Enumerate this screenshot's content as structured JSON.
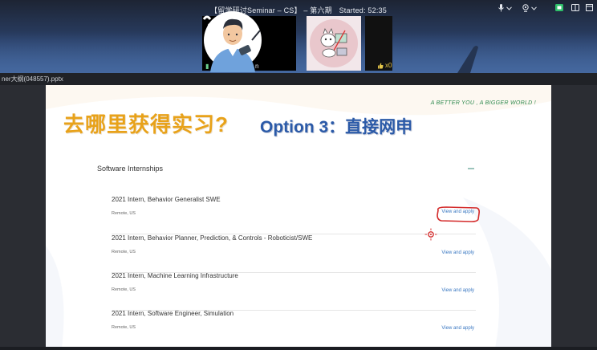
{
  "meeting": {
    "title": "【留学研讨Seminar – CS】 – 第六期",
    "started_label": "Started:",
    "started_time": "52:35",
    "thumbs_count": "x0"
  },
  "file": {
    "name": "ner大纲(048557).pptx"
  },
  "slide": {
    "tagline": "A BETTER YOU , A BIGGER WORLD !",
    "heading_cn": "去哪里获得实习?",
    "heading_option": "Option 3：直接网申",
    "section_title": "Software Internships",
    "jobs": [
      {
        "title": "2021 Intern, Behavior Generalist SWE",
        "location": "Remote, US",
        "link": "View and apply"
      },
      {
        "title": "2021 Intern, Behavior Planner, Prediction, & Controls - Roboticist/SWE",
        "location": "Remote, US",
        "link": "View and apply"
      },
      {
        "title": "2021 Intern, Machine Learning Infrastructure",
        "location": "Remote, US",
        "link": "View and apply"
      },
      {
        "title": "2021 Intern, Software Engineer, Simulation",
        "location": "Remote, US",
        "link": "View and apply"
      }
    ]
  },
  "colors": {
    "heading_cn": "#e8a21a",
    "heading_option": "#2b5aa8",
    "tagline": "#2f8a4f",
    "link": "#3a78c2",
    "annotation": "#d42b2b"
  }
}
